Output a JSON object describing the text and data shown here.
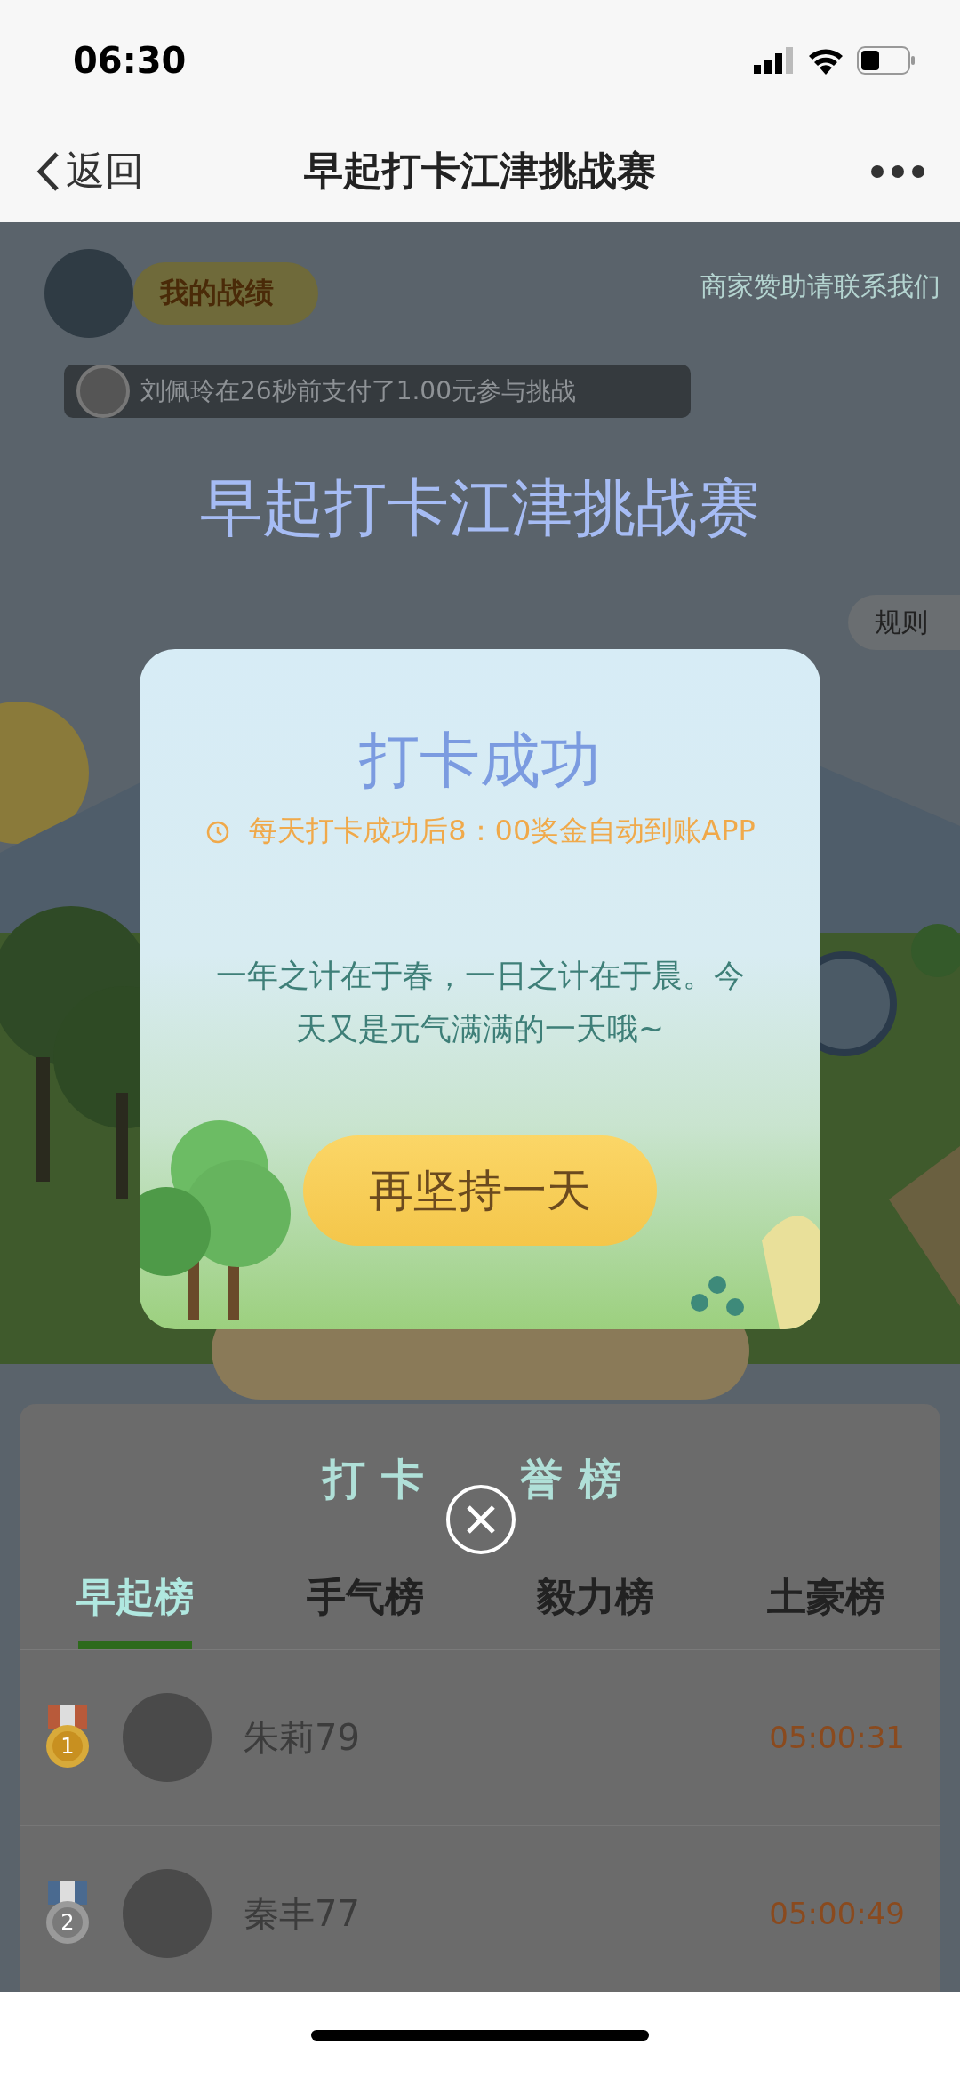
{
  "status_bar": {
    "time": "06:30"
  },
  "nav": {
    "back_label": "返回",
    "title": "早起打卡江津挑战赛"
  },
  "header": {
    "my_record_label": "我的战绩",
    "sponsor_link": "商家赞助请联系我们"
  },
  "ticker": {
    "text": "刘佩玲在26秒前支付了1.00元参与挑战"
  },
  "event_title": "早起打卡江津挑战赛",
  "rules_label": "规则",
  "leaderboard": {
    "title_parts": [
      "打卡",
      "誉榜"
    ],
    "tabs": [
      {
        "label": "早起榜",
        "selected": true
      },
      {
        "label": "手气榜",
        "selected": false
      },
      {
        "label": "毅力榜",
        "selected": false
      },
      {
        "label": "土豪榜",
        "selected": false
      }
    ],
    "rows": [
      {
        "rank": "1",
        "name": "朱莉79",
        "time": "05:00:31"
      },
      {
        "rank": "2",
        "name": "秦丰77",
        "time": "05:00:49"
      }
    ]
  },
  "modal": {
    "title": "打卡成功",
    "notice": "每天打卡成功后8：00奖金自动到账APP",
    "message": "一年之计在于春，一日之计在于晨。今天又是元气满满的一天哦~",
    "button": "再坚持一天"
  }
}
